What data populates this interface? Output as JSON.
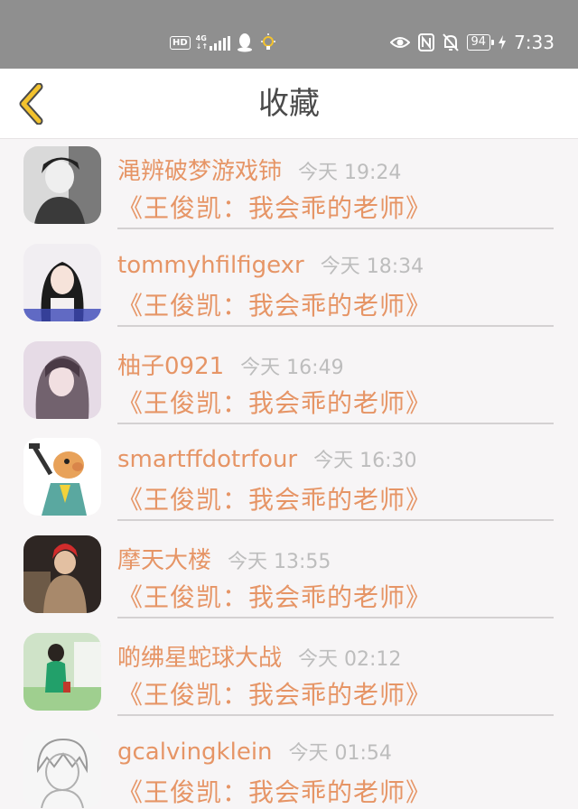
{
  "status_bar": {
    "hd": "HD",
    "network": "4G",
    "time": "7:33",
    "battery": "94"
  },
  "header": {
    "title": "收藏"
  },
  "colors": {
    "accent": "#e69566",
    "back_arrow": "#f2c22e",
    "muted": "#bdbdbd"
  },
  "favorites": [
    {
      "username": "渑辨破梦游戏铈",
      "time": "今天 19:24",
      "subject": "《王俊凯：我会乖的老师》",
      "avatar": "avatar-bw-boy"
    },
    {
      "username": "tommyhfilfigexr",
      "time": "今天 18:34",
      "subject": "《王俊凯：我会乖的老师》",
      "avatar": "avatar-girl-long-hair"
    },
    {
      "username": "柚子0921",
      "time": "今天 16:49",
      "subject": "《王俊凯：我会乖的老师》",
      "avatar": "avatar-blurred-girl"
    },
    {
      "username": "smartffdotrfour",
      "time": "今天 16:30",
      "subject": "《王俊凯：我会乖的老师》",
      "avatar": "avatar-cartoon-man"
    },
    {
      "username": "摩天大楼",
      "time": "今天 13:55",
      "subject": "《王俊凯：我会乖的老师》",
      "avatar": "avatar-red-hair"
    },
    {
      "username": "啲绋星蛇球大战",
      "time": "今天 02:12",
      "subject": "《王俊凯：我会乖的老师》",
      "avatar": "avatar-green-shirt"
    },
    {
      "username": "gcalvingklein",
      "time": "今天 01:54",
      "subject": "《王俊凯：我会乖的老师》",
      "avatar": "avatar-sketch-anime"
    }
  ]
}
